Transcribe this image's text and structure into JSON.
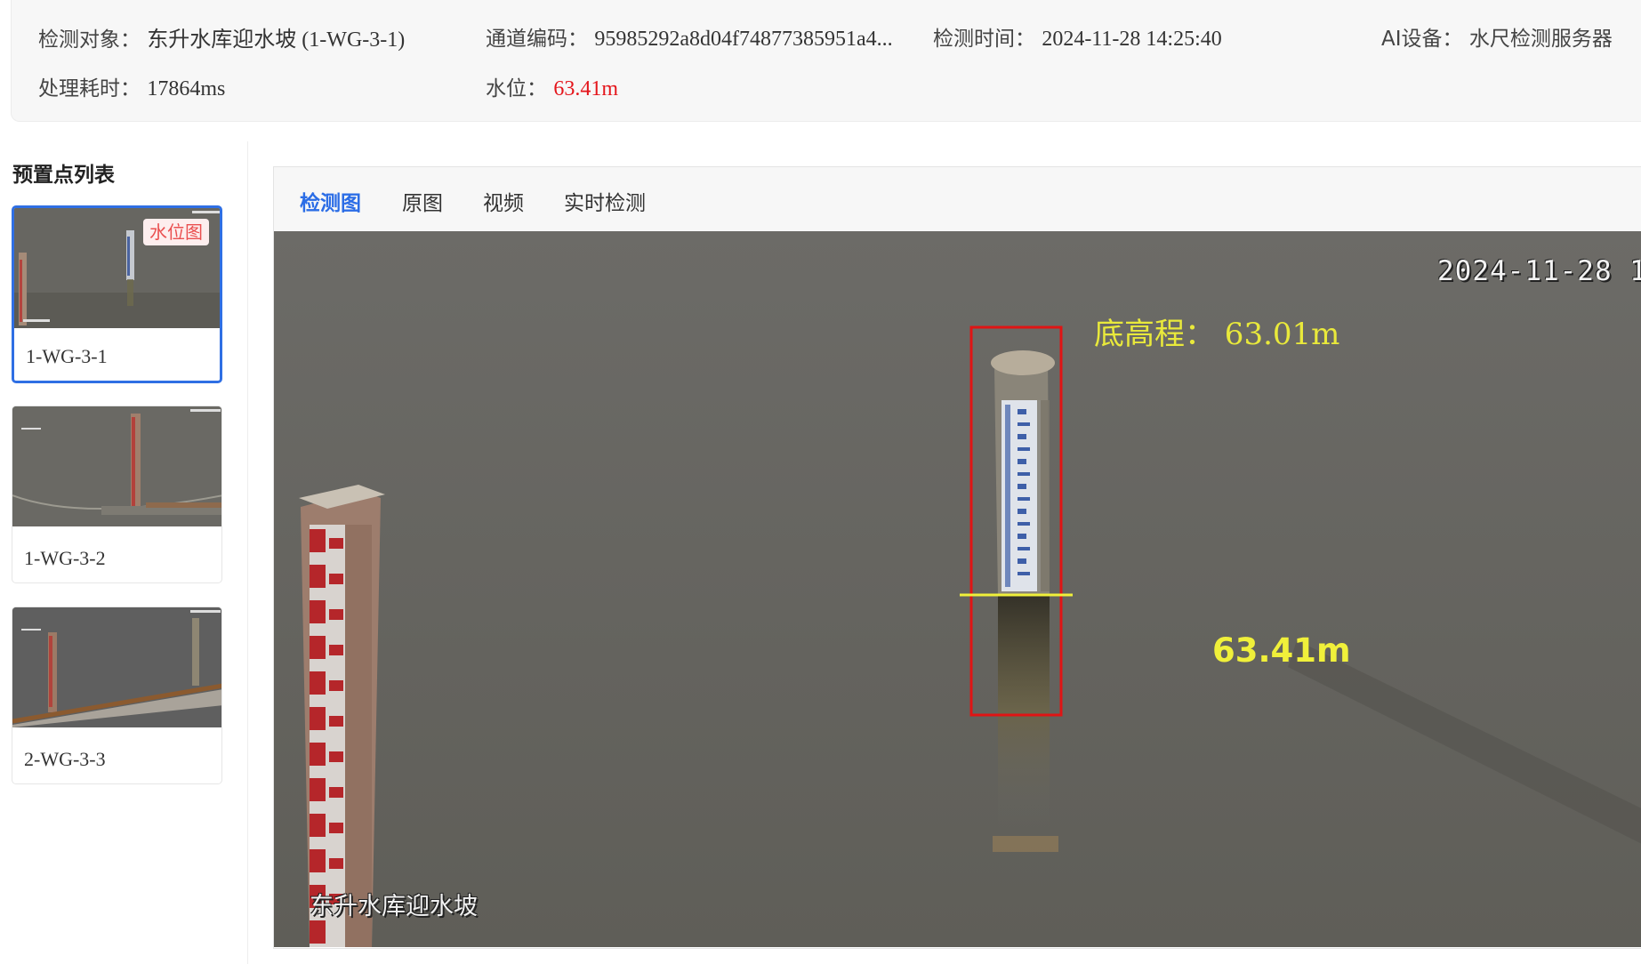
{
  "info": {
    "target_label": "检测对象：",
    "target_value": "东升水库迎水坡 (1-WG-3-1)",
    "channel_label": "通道编码：",
    "channel_value": "95985292a8d04f74877385951a4...",
    "time_label": "检测时间：",
    "time_value": "2024-11-28 14:25:40",
    "device_label": "AI设备：",
    "device_value": "水尺检测服务器",
    "duration_label": "处理耗时：",
    "duration_value": "17864ms",
    "level_label": "水位：",
    "level_value": "63.41m",
    "level_color": "#e4151b"
  },
  "sidebar": {
    "title": "预置点列表",
    "items": [
      {
        "label": "1-WG-3-1",
        "badge": "水位图",
        "active": true
      },
      {
        "label": "1-WG-3-2",
        "active": false
      },
      {
        "label": "2-WG-3-3",
        "active": false
      }
    ]
  },
  "tabs": [
    {
      "label": "检测图",
      "active": true
    },
    {
      "label": "原图",
      "active": false
    },
    {
      "label": "视频",
      "active": false
    },
    {
      "label": "实时检测",
      "active": false
    }
  ],
  "viewer": {
    "osd_time": "2024-11-28 1",
    "osd_name": "东升水库迎水坡",
    "bottom_elevation": "底高程：  63.01m",
    "water_level": "63.41m",
    "annotation_box_color": "#e01414",
    "annotation_text_color": "#f0f03a"
  },
  "colors": {
    "accent": "#2b6de6",
    "active_border": "#2f6fe4",
    "badge_text": "#ea5050"
  }
}
